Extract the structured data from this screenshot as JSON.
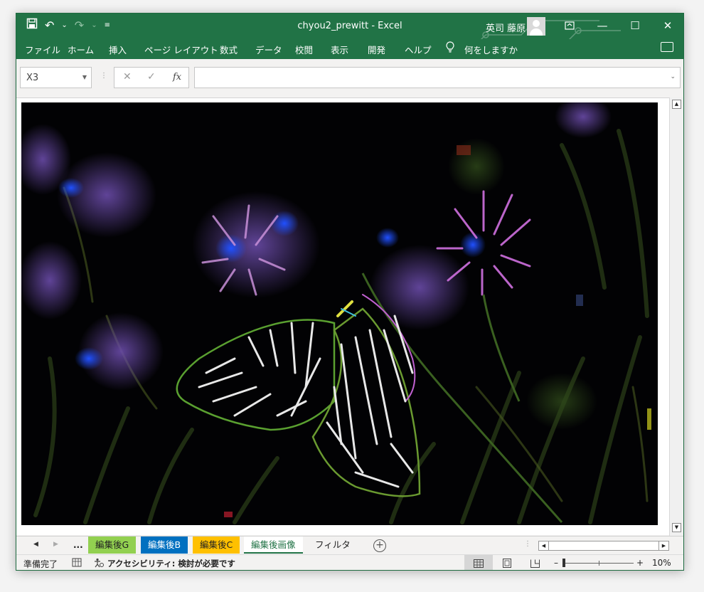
{
  "window": {
    "document_title": "chyou2_prewitt  -  Excel",
    "user_name": "英司 藤原"
  },
  "ribbon": {
    "tabs": [
      "ファイル",
      "ホーム",
      "挿入",
      "ページ レイアウト",
      "数式",
      "データ",
      "校閲",
      "表示",
      "開発",
      "ヘルプ"
    ],
    "tell_me": "何をしますか"
  },
  "formula_bar": {
    "name_box": "X3",
    "formula_value": ""
  },
  "sheets": {
    "ellipsis": "...",
    "tabs": [
      {
        "label": "編集後G",
        "color": "#92d050"
      },
      {
        "label": "編集後B",
        "color": "#0070c0"
      },
      {
        "label": "編集後C",
        "color": "#ffc000"
      },
      {
        "label": "編集後画像",
        "color": "#ffffff"
      },
      {
        "label": "フィルタ",
        "color": "#f3f2f1"
      }
    ],
    "active_index": 3
  },
  "status_bar": {
    "ready": "準備完了",
    "accessibility": "アクセシビリティ: 検討が必要です",
    "zoom": "10%"
  },
  "icons": {
    "save": "save-icon",
    "undo": "undo-icon",
    "redo": "redo-icon",
    "lightbulb": "lightbulb-icon",
    "comment": "comment-icon"
  },
  "colors": {
    "excel_green": "#217346"
  }
}
